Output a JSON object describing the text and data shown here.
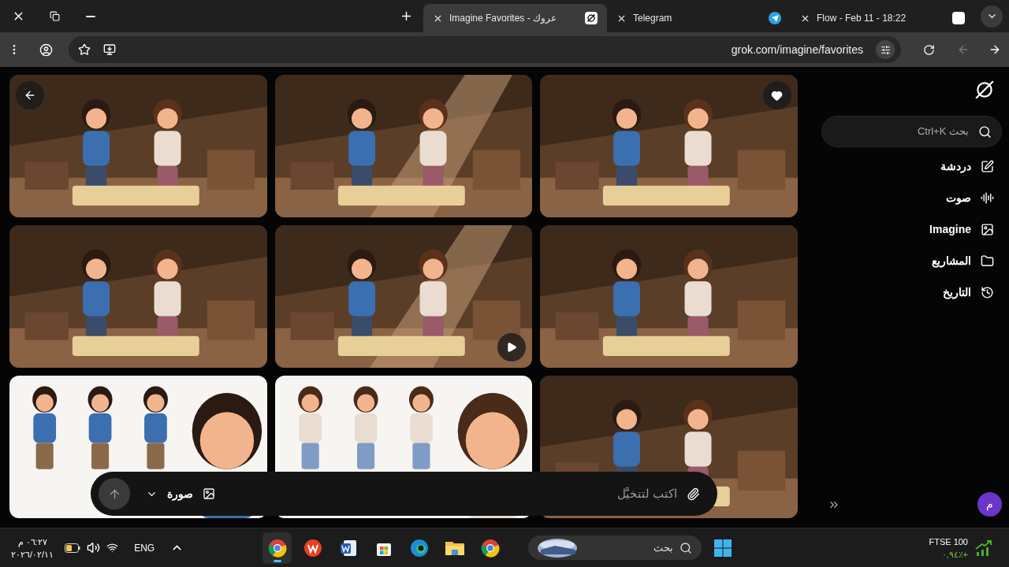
{
  "browser": {
    "tabs": [
      {
        "title": "Flow - Feb 11 - 18:22",
        "selected": false
      },
      {
        "title": "Telegram",
        "selected": false
      },
      {
        "title": "Imagine Favorites - عروك",
        "selected": true
      }
    ],
    "url": "grok.com/imagine/favorites"
  },
  "sidebar": {
    "search": {
      "placeholder": "بحث Ctrl+K"
    },
    "items": [
      {
        "label": "دردشة"
      },
      {
        "label": "صوت"
      },
      {
        "label": "Imagine"
      },
      {
        "label": "المشاريع"
      },
      {
        "label": "التاريخ"
      }
    ],
    "avatar": "م"
  },
  "prompt": {
    "placeholder": "اكتب لتتخيَّل",
    "mode": "صورة"
  },
  "taskbar": {
    "time": "٠٦:٢٧ م",
    "date": "٢٠٢٦/٠٢/١١",
    "language": "ENG",
    "search": {
      "placeholder": "بحث"
    },
    "apps": [
      {
        "kind": "chrome",
        "selected": true
      },
      {
        "kind": "wps",
        "selected": false
      },
      {
        "kind": "word",
        "selected": false
      },
      {
        "kind": "store",
        "selected": false
      },
      {
        "kind": "edge",
        "selected": false
      },
      {
        "kind": "folder",
        "selected": false
      },
      {
        "kind": "chrome",
        "selected": false
      }
    ],
    "ticker": {
      "name": "FTSE 100",
      "change": "٠,٩٤٪+"
    }
  }
}
